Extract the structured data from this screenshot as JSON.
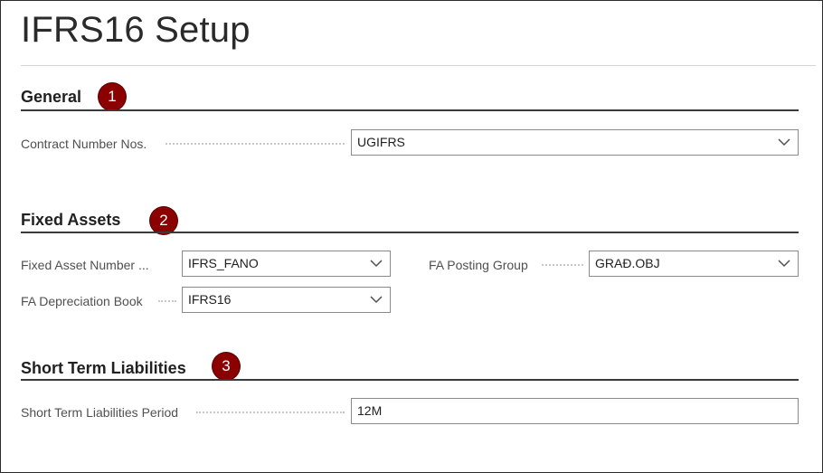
{
  "page": {
    "title": "IFRS16 Setup"
  },
  "sections": {
    "general": {
      "heading": "General",
      "callout": "1",
      "contract_number_nos": {
        "label": "Contract Number Nos.",
        "value": "UGIFRS"
      }
    },
    "fixed_assets": {
      "heading": "Fixed Assets",
      "callout": "2",
      "fixed_asset_number": {
        "label": "Fixed Asset Number ...",
        "value": "IFRS_FANO"
      },
      "fa_depreciation_book": {
        "label": "FA Depreciation Book",
        "value": "IFRS16"
      },
      "fa_posting_group": {
        "label": "FA Posting Group",
        "value": "GRAĐ.OBJ"
      }
    },
    "short_term_liabilities": {
      "heading": "Short Term Liabilities",
      "callout": "3",
      "period": {
        "label": "Short Term Liabilities Period",
        "value": "12M"
      }
    }
  },
  "icons": {
    "dropdown": "chevron-down-icon"
  },
  "colors": {
    "callout": "#8b0000",
    "section_rule": "#3a3a3a"
  }
}
